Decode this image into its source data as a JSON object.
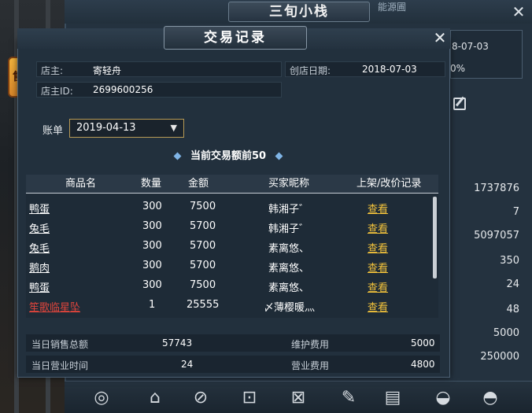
{
  "background": {
    "window_title": "三旬小栈",
    "corner_text": "能源圃",
    "open_date": "8-07-03",
    "rate_text": "0%",
    "stats": [
      "1737876",
      "7",
      "5097057",
      "350",
      "24",
      "48",
      "5000",
      "250000"
    ]
  },
  "lantern": {
    "glyph": "售"
  },
  "dialog": {
    "title": "交易记录",
    "close": "✕",
    "owner_label": "店主:",
    "owner_value": "寄轻舟",
    "open_date_label": "创店日期:",
    "open_date_value": "2018-07-03",
    "owner_id_label": "店主ID:",
    "owner_id_value": "2699600256",
    "ledger_label": "账单",
    "ledger_date": "2019-04-13",
    "banner": "当前交易额前50",
    "columns": [
      "商品名",
      "数量",
      "金额",
      "买家昵称",
      "上架/改价记录"
    ],
    "rows": [
      {
        "item": "鸭蛋",
        "qty": "300",
        "amount": "7500",
        "buyer": "韩湘子゛",
        "action": "查看",
        "rare": false
      },
      {
        "item": "兔毛",
        "qty": "300",
        "amount": "5700",
        "buyer": "韩湘子゛",
        "action": "查看",
        "rare": false
      },
      {
        "item": "兔毛",
        "qty": "300",
        "amount": "5700",
        "buyer": "素离悠、",
        "action": "查看",
        "rare": false
      },
      {
        "item": "鹅肉",
        "qty": "300",
        "amount": "5700",
        "buyer": "素离悠、",
        "action": "查看",
        "rare": false
      },
      {
        "item": "鸭蛋",
        "qty": "300",
        "amount": "7500",
        "buyer": "素离悠、",
        "action": "查看",
        "rare": false
      },
      {
        "item": "笙歌临星坠",
        "qty": "1",
        "amount": "25555",
        "buyer": "〆薄樱暖灬",
        "action": "查看",
        "rare": true
      }
    ],
    "summary": {
      "daily_sales_label": "当日销售总额",
      "daily_sales_value": "57743",
      "maintenance_label": "维护费用",
      "maintenance_value": "5000",
      "business_time_label": "当日营业时间",
      "business_time_value": "24",
      "business_fee_label": "营业费用",
      "business_fee_value": "4800"
    }
  },
  "toolbar": {
    "icons": [
      "compass-icon",
      "shop-icon",
      "no-shop-icon",
      "shop-in-icon",
      "shop-out-icon",
      "brush-icon",
      "scroll-icon",
      "bowl-down-icon",
      "bowl-up-icon"
    ]
  }
}
